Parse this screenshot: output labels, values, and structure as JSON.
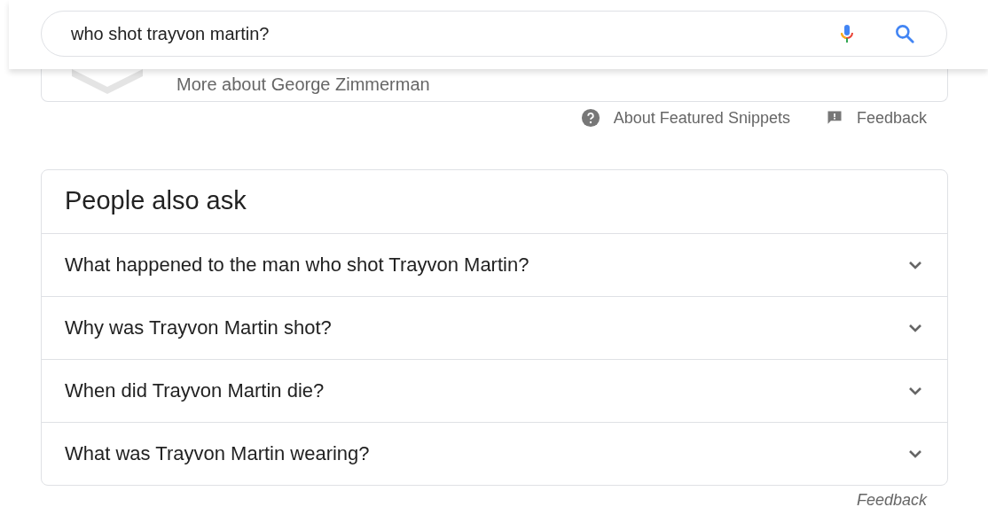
{
  "search": {
    "value": "who shot trayvon martin?"
  },
  "snippet_card": {
    "link": "More about George Zimmerman"
  },
  "snippet_footer": {
    "about": "About Featured Snippets",
    "feedback": "Feedback"
  },
  "people_also_ask": {
    "title": "People also ask",
    "questions": [
      {
        "text": "What happened to the man who shot Trayvon Martin?",
        "expanded": false
      },
      {
        "text": "Why was Trayvon Martin shot?",
        "expanded": false
      },
      {
        "text": "When did Trayvon Martin die?",
        "expanded": false
      },
      {
        "text": "What was Trayvon Martin wearing?",
        "expanded": false
      }
    ]
  },
  "footer": {
    "feedback": "Feedback"
  }
}
